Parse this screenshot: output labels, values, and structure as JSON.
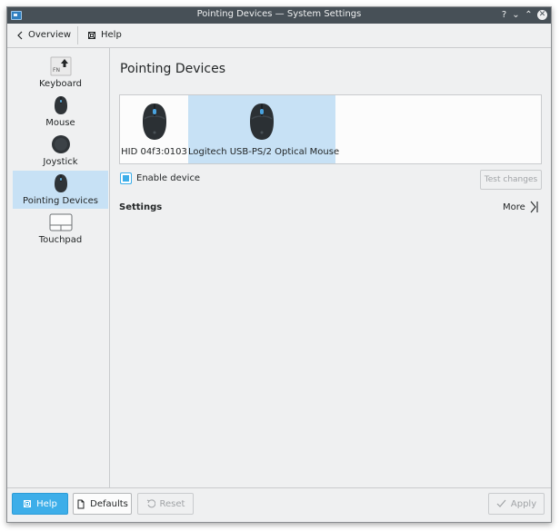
{
  "window": {
    "title": "Pointing Devices  — System Settings"
  },
  "titlebar": {
    "help_glyph": "?",
    "minimize_glyph": "⌄",
    "maximize_glyph": "⌃",
    "close_glyph": "✕"
  },
  "toolbar": {
    "overview_label": "Overview",
    "help_label": "Help"
  },
  "sidebar": {
    "items": [
      {
        "label": "Keyboard",
        "icon": "keyboard-key-icon"
      },
      {
        "label": "Mouse",
        "icon": "mouse-icon"
      },
      {
        "label": "Joystick",
        "icon": "joystick-icon"
      },
      {
        "label": "Pointing Devices",
        "icon": "mouse-icon",
        "selected": true
      },
      {
        "label": "Touchpad",
        "icon": "touchpad-icon"
      }
    ],
    "keyboard_key_text": "FN"
  },
  "main": {
    "title": "Pointing Devices",
    "devices": [
      {
        "label": "HID 04f3:0103",
        "selected": false
      },
      {
        "label": "Logitech USB-PS/2 Optical Mouse",
        "selected": true
      }
    ],
    "enable_label": "Enable device",
    "enable_checked": true,
    "test_label": "Test changes",
    "settings_label": "Settings",
    "more_label": "More"
  },
  "buttons": {
    "help": "Help",
    "defaults": "Defaults",
    "reset": "Reset",
    "apply": "Apply"
  },
  "colors": {
    "accent": "#3daee9",
    "selection": "#c7e1f5",
    "titlebar": "#475057",
    "background": "#eff0f1"
  }
}
